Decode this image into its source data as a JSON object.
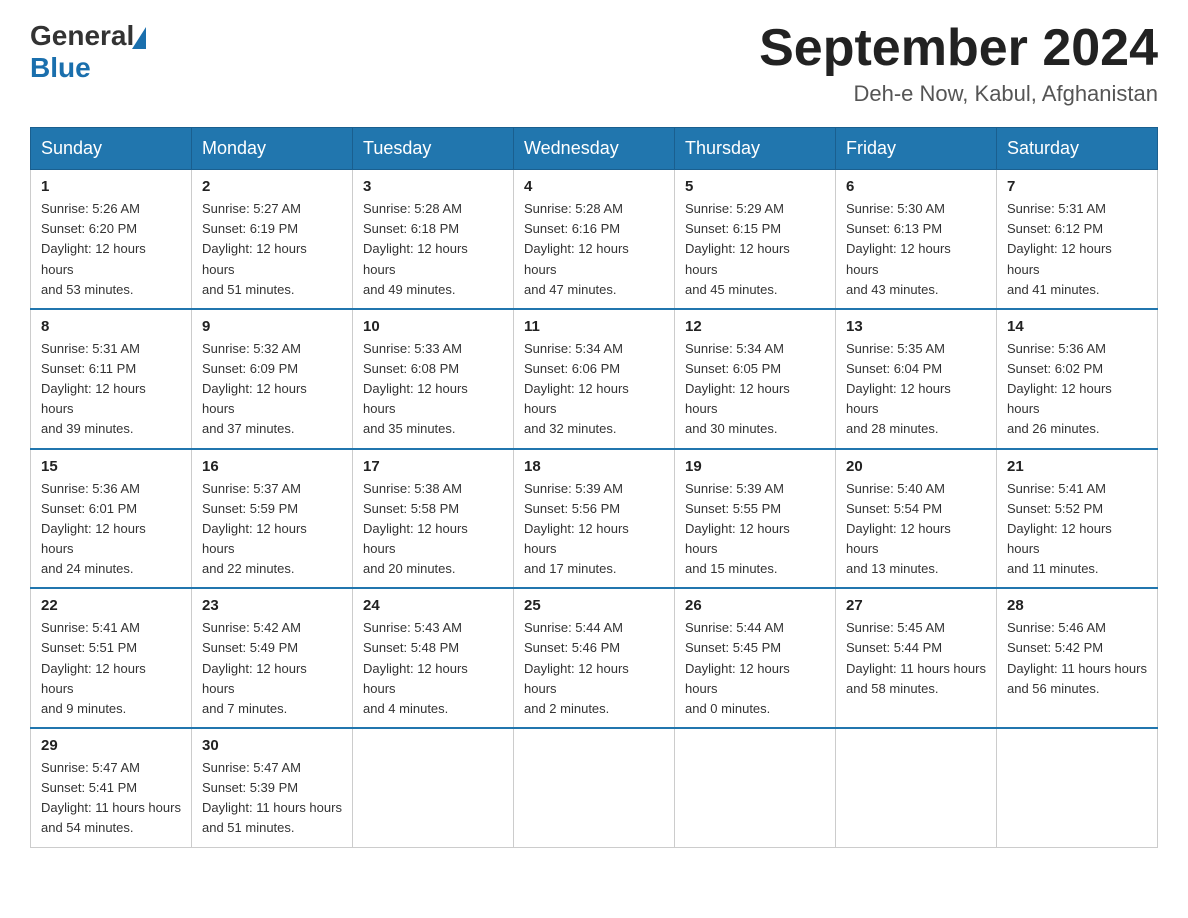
{
  "header": {
    "logo_general": "General",
    "logo_blue": "Blue",
    "calendar_title": "September 2024",
    "calendar_subtitle": "Deh-e Now, Kabul, Afghanistan"
  },
  "weekdays": [
    "Sunday",
    "Monday",
    "Tuesday",
    "Wednesday",
    "Thursday",
    "Friday",
    "Saturday"
  ],
  "weeks": [
    [
      {
        "day": "1",
        "sunrise": "5:26 AM",
        "sunset": "6:20 PM",
        "daylight": "12 hours and 53 minutes."
      },
      {
        "day": "2",
        "sunrise": "5:27 AM",
        "sunset": "6:19 PM",
        "daylight": "12 hours and 51 minutes."
      },
      {
        "day": "3",
        "sunrise": "5:28 AM",
        "sunset": "6:18 PM",
        "daylight": "12 hours and 49 minutes."
      },
      {
        "day": "4",
        "sunrise": "5:28 AM",
        "sunset": "6:16 PM",
        "daylight": "12 hours and 47 minutes."
      },
      {
        "day": "5",
        "sunrise": "5:29 AM",
        "sunset": "6:15 PM",
        "daylight": "12 hours and 45 minutes."
      },
      {
        "day": "6",
        "sunrise": "5:30 AM",
        "sunset": "6:13 PM",
        "daylight": "12 hours and 43 minutes."
      },
      {
        "day": "7",
        "sunrise": "5:31 AM",
        "sunset": "6:12 PM",
        "daylight": "12 hours and 41 minutes."
      }
    ],
    [
      {
        "day": "8",
        "sunrise": "5:31 AM",
        "sunset": "6:11 PM",
        "daylight": "12 hours and 39 minutes."
      },
      {
        "day": "9",
        "sunrise": "5:32 AM",
        "sunset": "6:09 PM",
        "daylight": "12 hours and 37 minutes."
      },
      {
        "day": "10",
        "sunrise": "5:33 AM",
        "sunset": "6:08 PM",
        "daylight": "12 hours and 35 minutes."
      },
      {
        "day": "11",
        "sunrise": "5:34 AM",
        "sunset": "6:06 PM",
        "daylight": "12 hours and 32 minutes."
      },
      {
        "day": "12",
        "sunrise": "5:34 AM",
        "sunset": "6:05 PM",
        "daylight": "12 hours and 30 minutes."
      },
      {
        "day": "13",
        "sunrise": "5:35 AM",
        "sunset": "6:04 PM",
        "daylight": "12 hours and 28 minutes."
      },
      {
        "day": "14",
        "sunrise": "5:36 AM",
        "sunset": "6:02 PM",
        "daylight": "12 hours and 26 minutes."
      }
    ],
    [
      {
        "day": "15",
        "sunrise": "5:36 AM",
        "sunset": "6:01 PM",
        "daylight": "12 hours and 24 minutes."
      },
      {
        "day": "16",
        "sunrise": "5:37 AM",
        "sunset": "5:59 PM",
        "daylight": "12 hours and 22 minutes."
      },
      {
        "day": "17",
        "sunrise": "5:38 AM",
        "sunset": "5:58 PM",
        "daylight": "12 hours and 20 minutes."
      },
      {
        "day": "18",
        "sunrise": "5:39 AM",
        "sunset": "5:56 PM",
        "daylight": "12 hours and 17 minutes."
      },
      {
        "day": "19",
        "sunrise": "5:39 AM",
        "sunset": "5:55 PM",
        "daylight": "12 hours and 15 minutes."
      },
      {
        "day": "20",
        "sunrise": "5:40 AM",
        "sunset": "5:54 PM",
        "daylight": "12 hours and 13 minutes."
      },
      {
        "day": "21",
        "sunrise": "5:41 AM",
        "sunset": "5:52 PM",
        "daylight": "12 hours and 11 minutes."
      }
    ],
    [
      {
        "day": "22",
        "sunrise": "5:41 AM",
        "sunset": "5:51 PM",
        "daylight": "12 hours and 9 minutes."
      },
      {
        "day": "23",
        "sunrise": "5:42 AM",
        "sunset": "5:49 PM",
        "daylight": "12 hours and 7 minutes."
      },
      {
        "day": "24",
        "sunrise": "5:43 AM",
        "sunset": "5:48 PM",
        "daylight": "12 hours and 4 minutes."
      },
      {
        "day": "25",
        "sunrise": "5:44 AM",
        "sunset": "5:46 PM",
        "daylight": "12 hours and 2 minutes."
      },
      {
        "day": "26",
        "sunrise": "5:44 AM",
        "sunset": "5:45 PM",
        "daylight": "12 hours and 0 minutes."
      },
      {
        "day": "27",
        "sunrise": "5:45 AM",
        "sunset": "5:44 PM",
        "daylight": "11 hours and 58 minutes."
      },
      {
        "day": "28",
        "sunrise": "5:46 AM",
        "sunset": "5:42 PM",
        "daylight": "11 hours and 56 minutes."
      }
    ],
    [
      {
        "day": "29",
        "sunrise": "5:47 AM",
        "sunset": "5:41 PM",
        "daylight": "11 hours and 54 minutes."
      },
      {
        "day": "30",
        "sunrise": "5:47 AM",
        "sunset": "5:39 PM",
        "daylight": "11 hours and 51 minutes."
      },
      null,
      null,
      null,
      null,
      null
    ]
  ],
  "labels": {
    "sunrise": "Sunrise:",
    "sunset": "Sunset:",
    "daylight": "Daylight:"
  }
}
